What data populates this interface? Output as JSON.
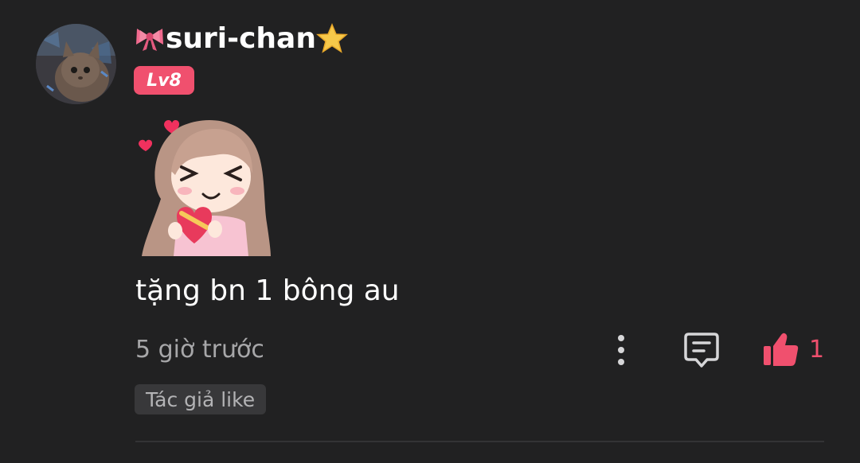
{
  "comment": {
    "username": "suri-chan",
    "username_prefix_icon": "ribbon-icon",
    "username_suffix_icon": "star-icon",
    "level_badge": "Lv8",
    "sticker": "chibi-girl-heart-sticker",
    "text": "tặng bn 1 bông au",
    "timestamp": "5 giờ trước",
    "like_count": "1",
    "author_like_label": "Tác giả like"
  },
  "colors": {
    "background": "#212122",
    "accent": "#f0506e",
    "muted_text": "#a7a7a9",
    "icon": "#d6d6d8"
  }
}
